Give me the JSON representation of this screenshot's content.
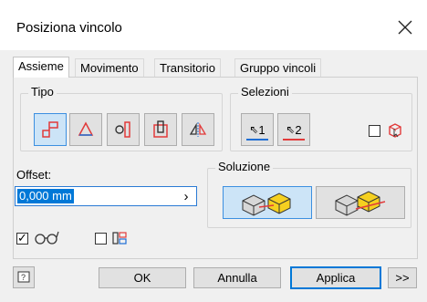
{
  "window": {
    "title": "Posiziona vincolo"
  },
  "tabs": [
    {
      "label": "Assieme",
      "active": true
    },
    {
      "label": "Movimento",
      "active": false
    },
    {
      "label": "Transitorio",
      "active": false
    },
    {
      "label": "Gruppo vincoli",
      "active": false
    }
  ],
  "tipo": {
    "label": "Tipo",
    "buttons": [
      {
        "icon": "mate-constraint-icon",
        "pressed": true
      },
      {
        "icon": "angle-constraint-icon",
        "pressed": false
      },
      {
        "icon": "tangent-constraint-icon",
        "pressed": false
      },
      {
        "icon": "insert-constraint-icon",
        "pressed": false
      },
      {
        "icon": "symmetry-constraint-icon",
        "pressed": false
      }
    ]
  },
  "selezioni": {
    "label": "Selezioni",
    "first_label": "1",
    "second_label": "2",
    "first_color": "#1f6ed4",
    "second_color": "#e23a3a",
    "pick_part_first_checked": false
  },
  "offset": {
    "label": "Offset:",
    "value": "0,000 mm"
  },
  "soluzione": {
    "label": "Soluzione",
    "options": [
      {
        "icon": "mate-solution-icon",
        "pressed": true
      },
      {
        "icon": "flush-solution-icon",
        "pressed": false
      }
    ]
  },
  "options": {
    "show_preview_checked": true,
    "predict_offset_checked": false
  },
  "footer": {
    "help_icon": "help-icon",
    "ok_label": "OK",
    "cancel_label": "Annulla",
    "apply_label": "Applica",
    "more_label": ">>"
  },
  "colors": {
    "accent": "#0078d7",
    "pressed_bg": "#cce4f7",
    "red": "#e23a3a",
    "yellow": "#f5d020"
  }
}
